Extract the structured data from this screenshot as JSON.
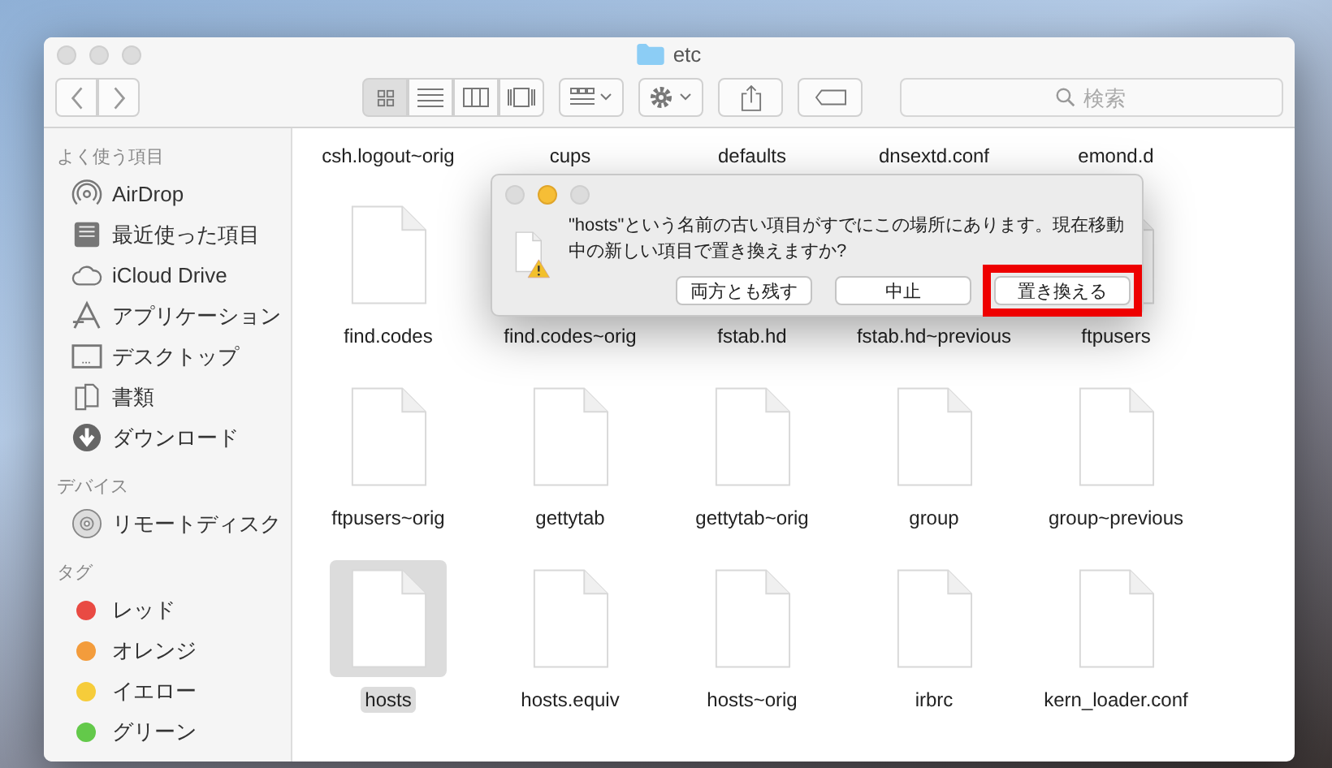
{
  "window": {
    "title": "etc"
  },
  "toolbar": {
    "view_modes": [
      {
        "kind": "icons",
        "selected": true
      },
      {
        "kind": "list",
        "selected": false
      },
      {
        "kind": "columns",
        "selected": false
      },
      {
        "kind": "gallery",
        "selected": false
      }
    ],
    "search": {
      "placeholder": "検索"
    }
  },
  "sidebar": {
    "sections": [
      {
        "title": "よく使う項目",
        "items": [
          {
            "kind": "airdrop",
            "label": "AirDrop"
          },
          {
            "kind": "recents",
            "label": "最近使った項目"
          },
          {
            "kind": "cloud",
            "label": "iCloud Drive"
          },
          {
            "kind": "apps",
            "label": "アプリケーション"
          },
          {
            "kind": "desktop",
            "label": "デスクトップ"
          },
          {
            "kind": "documents",
            "label": "書類"
          },
          {
            "kind": "downloads",
            "label": "ダウンロード"
          }
        ]
      },
      {
        "title": "デバイス",
        "items": [
          {
            "kind": "disc",
            "label": "リモートディスク"
          }
        ]
      },
      {
        "title": "タグ",
        "items": [
          {
            "kind": "tag",
            "label": "レッド",
            "color": "#e94a43"
          },
          {
            "kind": "tag",
            "label": "オレンジ",
            "color": "#f39c3c"
          },
          {
            "kind": "tag",
            "label": "イエロー",
            "color": "#f6cc3a"
          },
          {
            "kind": "tag",
            "label": "グリーン",
            "color": "#63c94a"
          }
        ]
      }
    ]
  },
  "partial_row": {
    "files": [
      {
        "name": "csh.logout~orig"
      },
      {
        "name": "cups"
      },
      {
        "name": "defaults"
      },
      {
        "name": "dnsextd.conf"
      },
      {
        "name": "emond.d"
      }
    ]
  },
  "file_rows": [
    {
      "files": [
        {
          "name": "find.codes",
          "selected": false
        },
        {
          "name": "find.codes~orig",
          "selected": false
        },
        {
          "name": "fstab.hd",
          "selected": false
        },
        {
          "name": "fstab.hd~previous",
          "selected": false
        },
        {
          "name": "ftpusers",
          "selected": false
        }
      ]
    },
    {
      "files": [
        {
          "name": "ftpusers~orig",
          "selected": false
        },
        {
          "name": "gettytab",
          "selected": false
        },
        {
          "name": "gettytab~orig",
          "selected": false
        },
        {
          "name": "group",
          "selected": false
        },
        {
          "name": "group~previous",
          "selected": false
        }
      ]
    },
    {
      "files": [
        {
          "name": "hosts",
          "selected": true
        },
        {
          "name": "hosts.equiv",
          "selected": false
        },
        {
          "name": "hosts~orig",
          "selected": false
        },
        {
          "name": "irbrc",
          "selected": false
        },
        {
          "name": "kern_loader.conf",
          "selected": false
        }
      ]
    }
  ],
  "dialog": {
    "message": "\"hosts\"という名前の古い項目がすでにこの場所にあります。現在移動中の新しい項目で置き換えますか?",
    "buttons": [
      {
        "label": "両方とも残す",
        "highlighted": false
      },
      {
        "label": "中止",
        "highlighted": false
      },
      {
        "label": "置き換える",
        "highlighted": true
      }
    ]
  }
}
